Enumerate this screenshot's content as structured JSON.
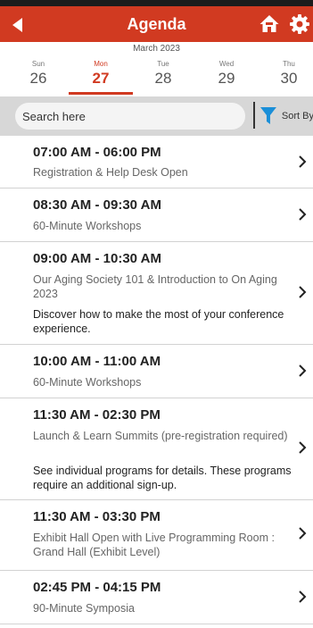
{
  "header": {
    "title": "Agenda",
    "back_icon": "back-arrow-icon",
    "home_icon": "home-icon",
    "settings_icon": "gear-icon",
    "color": "#d13a21"
  },
  "calendar": {
    "month": "March 2023",
    "days": [
      {
        "name": "Sun",
        "number": "26"
      },
      {
        "name": "Mon",
        "number": "27"
      },
      {
        "name": "Tue",
        "number": "28"
      },
      {
        "name": "Wed",
        "number": "29"
      },
      {
        "name": "Thu",
        "number": "30"
      }
    ],
    "selected": "Mon 27"
  },
  "search": {
    "placeholder": "Search here",
    "sort_label": "Sort By"
  },
  "sessions": [
    {
      "time": "07:00 AM - 06:00 PM",
      "title": "Registration & Help Desk Open",
      "desc": ""
    },
    {
      "time": "08:30 AM - 09:30 AM",
      "title": "60-Minute Workshops",
      "desc": ""
    },
    {
      "time": "09:00 AM - 10:30 AM",
      "title": "Our Aging Society 101 & Introduction to On Aging 2023",
      "desc": "Discover how to make the most of your conference experience."
    },
    {
      "time": "10:00 AM - 11:00 AM",
      "title": "60-Minute Workshops",
      "desc": ""
    },
    {
      "time": "11:30 AM - 02:30 PM",
      "title": "Launch & Learn Summits (pre-registration required)",
      "desc": "See individual programs for details. These programs require an additional sign-up."
    },
    {
      "time": "11:30 AM - 03:30 PM",
      "title": "Exhibit Hall Open with Live Programming Room : Grand Hall (Exhibit Level)",
      "desc": ""
    },
    {
      "time": "02:45 PM - 04:15 PM",
      "title": "90-Minute Symposia",
      "desc": ""
    }
  ]
}
